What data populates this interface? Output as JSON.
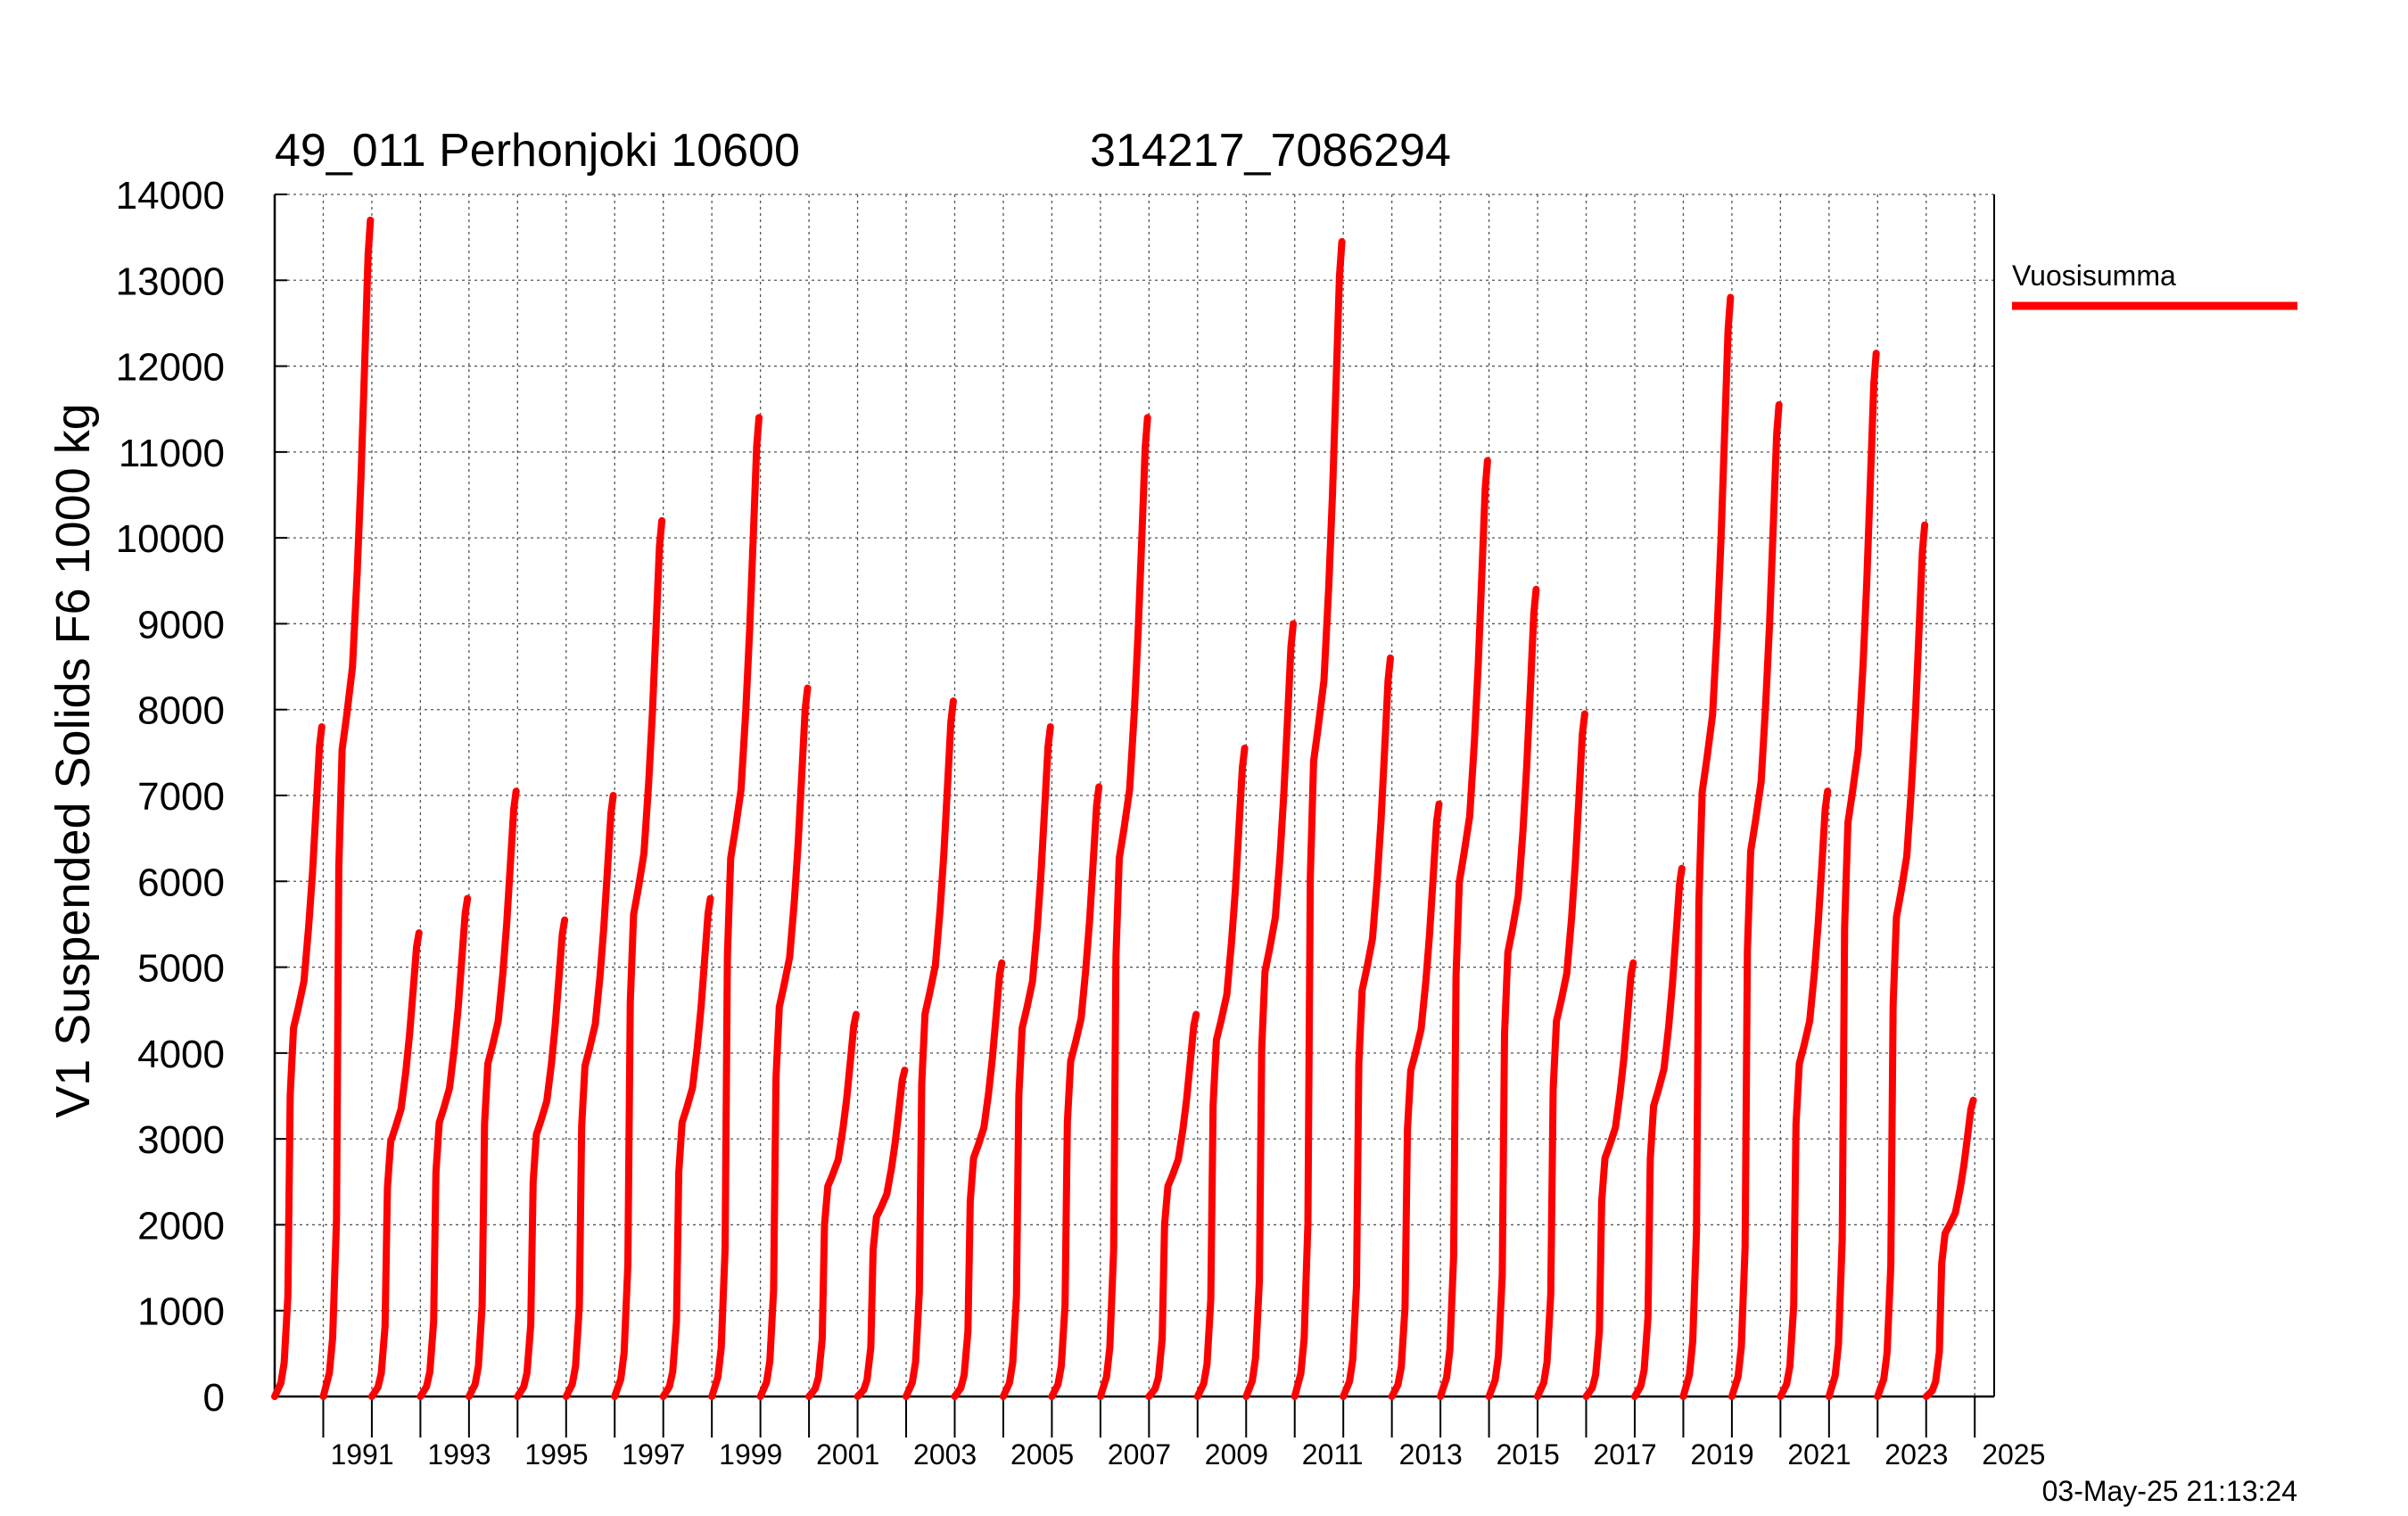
{
  "title_left": "49_011 Perhonjoki 10600",
  "title_right": "314217_7086294",
  "timestamp": "03-May-25 21:13:24",
  "chart_data": {
    "type": "line",
    "ylabel": "V1 Suspended Solids F6 1000 kg",
    "xlim": [
      1990,
      2025.4
    ],
    "ylim": [
      0,
      14000
    ],
    "grid": true,
    "legend_position": "right",
    "y_ticks": [
      0,
      1000,
      2000,
      3000,
      4000,
      5000,
      6000,
      7000,
      8000,
      9000,
      10000,
      11000,
      12000,
      13000,
      14000
    ],
    "x_tick_labels": [
      "1991",
      "1993",
      "1995",
      "1997",
      "1999",
      "2001",
      "2003",
      "2005",
      "2007",
      "2009",
      "2011",
      "2013",
      "2015",
      "2017",
      "2019",
      "2021",
      "2023",
      "2025"
    ],
    "series": [
      {
        "name": "Vuosisumma",
        "color": "#ff0000",
        "annual_totals": [
          {
            "year": 1990,
            "total": 7800
          },
          {
            "year": 1991,
            "total": 13700
          },
          {
            "year": 1992,
            "total": 5400
          },
          {
            "year": 1993,
            "total": 5800
          },
          {
            "year": 1994,
            "total": 7050
          },
          {
            "year": 1995,
            "total": 5550
          },
          {
            "year": 1996,
            "total": 7000
          },
          {
            "year": 1997,
            "total": 10200
          },
          {
            "year": 1998,
            "total": 5800
          },
          {
            "year": 1999,
            "total": 11400
          },
          {
            "year": 2000,
            "total": 8250
          },
          {
            "year": 2001,
            "total": 4450
          },
          {
            "year": 2002,
            "total": 3800
          },
          {
            "year": 2003,
            "total": 8100
          },
          {
            "year": 2004,
            "total": 5050
          },
          {
            "year": 2005,
            "total": 7800
          },
          {
            "year": 2006,
            "total": 7100
          },
          {
            "year": 2007,
            "total": 11400
          },
          {
            "year": 2008,
            "total": 4450
          },
          {
            "year": 2009,
            "total": 7550
          },
          {
            "year": 2010,
            "total": 9000
          },
          {
            "year": 2011,
            "total": 13450
          },
          {
            "year": 2012,
            "total": 8600
          },
          {
            "year": 2013,
            "total": 6900
          },
          {
            "year": 2014,
            "total": 10900
          },
          {
            "year": 2015,
            "total": 9400
          },
          {
            "year": 2016,
            "total": 7950
          },
          {
            "year": 2017,
            "total": 5050
          },
          {
            "year": 2018,
            "total": 6150
          },
          {
            "year": 2019,
            "total": 12800
          },
          {
            "year": 2020,
            "total": 11550
          },
          {
            "year": 2021,
            "total": 7050
          },
          {
            "year": 2022,
            "total": 12150
          },
          {
            "year": 2023,
            "total": 10150
          },
          {
            "year": 2024,
            "total": 3450
          }
        ]
      }
    ]
  }
}
